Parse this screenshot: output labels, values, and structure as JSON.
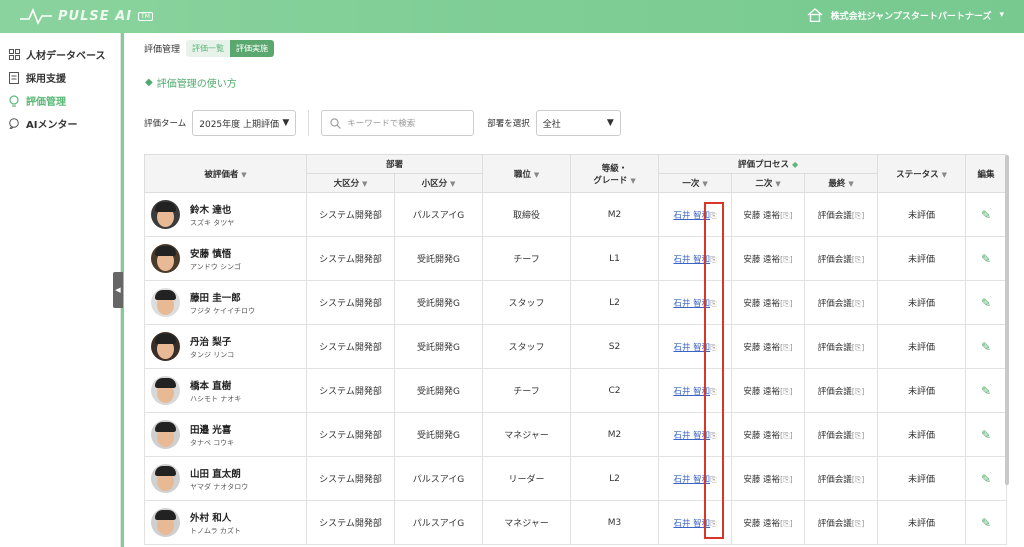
{
  "header": {
    "logo_text": "PULSE AI",
    "logo_badge": "TM",
    "company": "株式会社ジャンプスタートパートナーズ",
    "company_chevron": "▾"
  },
  "sidebar": {
    "items": [
      {
        "label": "人材データベース",
        "icon": "grid-icon",
        "active": false
      },
      {
        "label": "採用支援",
        "icon": "document-icon",
        "active": false
      },
      {
        "label": "評価管理",
        "icon": "bulb-icon",
        "active": true
      },
      {
        "label": "AIメンター",
        "icon": "chat-icon",
        "active": false
      }
    ],
    "collapse": "◀"
  },
  "breadcrumb": {
    "title": "評価管理",
    "tabs": [
      {
        "label": "評価一覧",
        "active": false
      },
      {
        "label": "評価実施",
        "active": true
      }
    ]
  },
  "howto": {
    "icon": "◆",
    "label": "評価管理の使い方"
  },
  "filters": {
    "term_label": "評価ターム",
    "term_value": "2025年度 上期評価",
    "search_placeholder": "キーワードで検索",
    "dept_label": "部署を選択",
    "dept_value": "全社",
    "caret": "▼"
  },
  "table": {
    "headers": {
      "evaluatee": "被評価者",
      "dept": "部署",
      "dept_major": "大区分",
      "dept_minor": "小区分",
      "position": "職位",
      "grade": "等級・\nグレード",
      "process": "評価プロセス",
      "first": "一次",
      "second": "二次",
      "final": "最終",
      "status": "ステータス",
      "edit": "編集",
      "sort": "▼"
    },
    "rows": [
      {
        "name": "鈴木 達也",
        "kana": "スズキ タツヤ",
        "major": "システム開発部",
        "minor": "パルスアイG",
        "position": "取締役",
        "grade": "M2",
        "first": "石井 智和",
        "second": "安藤 遠裕",
        "final": "評価会議",
        "status": "未評価"
      },
      {
        "name": "安藤 慎悟",
        "kana": "アンドウ シンゴ",
        "major": "システム開発部",
        "minor": "受託開発G",
        "position": "チーフ",
        "grade": "L1",
        "first": "石井 智和",
        "second": "安藤 遠裕",
        "final": "評価会議",
        "status": "未評価"
      },
      {
        "name": "藤田 圭一郎",
        "kana": "フジタ ケイイチロウ",
        "major": "システム開発部",
        "minor": "受託開発G",
        "position": "スタッフ",
        "grade": "L2",
        "first": "石井 智和",
        "second": "安藤 遠裕",
        "final": "評価会議",
        "status": "未評価"
      },
      {
        "name": "丹治 梨子",
        "kana": "タンジ リンコ",
        "major": "システム開発部",
        "minor": "受託開発G",
        "position": "スタッフ",
        "grade": "S2",
        "first": "石井 智和",
        "second": "安藤 遠裕",
        "final": "評価会議",
        "status": "未評価"
      },
      {
        "name": "橋本 直樹",
        "kana": "ハシモト ナオキ",
        "major": "システム開発部",
        "minor": "受託開発G",
        "position": "チーフ",
        "grade": "C2",
        "first": "石井 智和",
        "second": "安藤 遠裕",
        "final": "評価会議",
        "status": "未評価"
      },
      {
        "name": "田邉 光喜",
        "kana": "タナベ コウキ",
        "major": "システム開発部",
        "minor": "受託開発G",
        "position": "マネジャー",
        "grade": "M2",
        "first": "石井 智和",
        "second": "安藤 遠裕",
        "final": "評価会議",
        "status": "未評価"
      },
      {
        "name": "山田 直太朗",
        "kana": "ヤマダ ナオタロウ",
        "major": "システム開発部",
        "minor": "パルスアイG",
        "position": "リーダー",
        "grade": "L2",
        "first": "石井 智和",
        "second": "安藤 遠裕",
        "final": "評価会議",
        "status": "未評価"
      },
      {
        "name": "外村 和人",
        "kana": "トノムラ カズト",
        "major": "システム開発部",
        "minor": "パルスアイG",
        "position": "マネジャー",
        "grade": "M3",
        "first": "石井 智和",
        "second": "安藤 遠裕",
        "final": "評価会議",
        "status": "未評価"
      }
    ]
  },
  "colors": {
    "accent": "#5cb878",
    "header": "#7fce96",
    "highlight": "#d9362b",
    "link": "#3a64c8"
  }
}
